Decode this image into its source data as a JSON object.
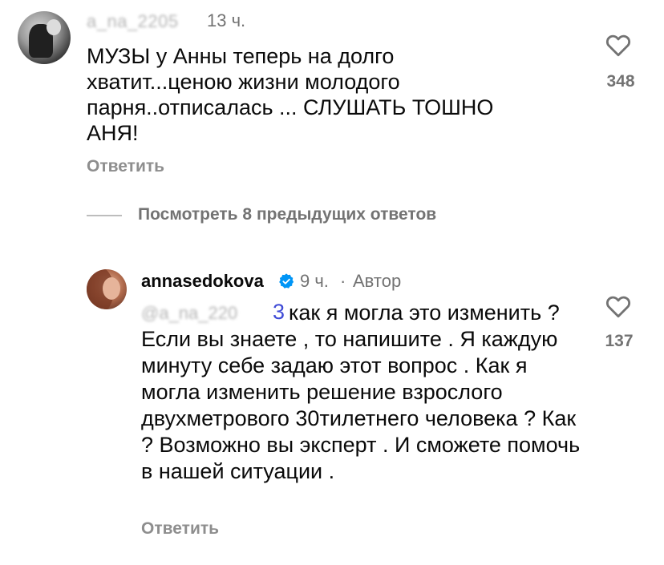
{
  "comment1": {
    "username": "a_na_2205",
    "time": "13 ч.",
    "text": "МУЗЫ у Анны теперь на долго хватит...ценою жизни молодого парня..отписалась ... СЛУШАТЬ ТОШНО АНЯ!",
    "reply_label": "Ответить",
    "likes": "348"
  },
  "view_previous": {
    "label": "Посмотреть 8 предыдущих ответов"
  },
  "comment2": {
    "username": "annasedokova",
    "time": "9 ч.",
    "separator": "·",
    "author_badge": "Автор",
    "mention_hidden": "@a_na_220",
    "mention_suffix": "3",
    "text": "как я могла это изменить ? Если вы знаете , то напишите . Я каждую минуту себе задаю этот вопрос . Как я могла изменить решение взрослого двухметрового 30тилетнего человека ? Как ? Возможно вы эксперт . И сможете помочь в нашей ситуации .",
    "reply_label": "Ответить",
    "likes": "137"
  },
  "colors": {
    "primary_text": "#0a0a0a",
    "secondary_text": "#737373",
    "mention": "#3f4bd6",
    "verified": "#0095f6"
  },
  "icons": {
    "like": "heart-outline-icon",
    "verified": "verified-badge-icon"
  }
}
